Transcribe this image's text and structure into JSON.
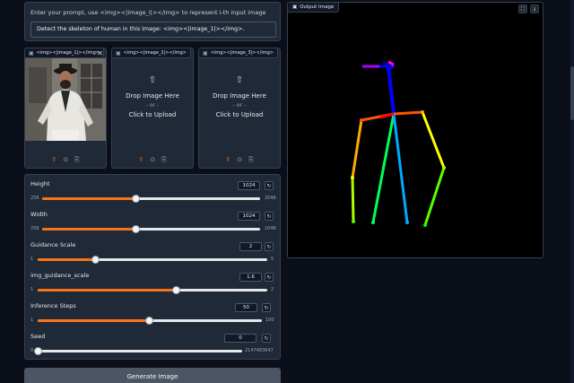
{
  "prompt": {
    "label": "Enter your prompt, use <img><|image_i|></img> to represent i-th input image",
    "value": "Detect the skeleton of human in this image: <img><|image_1|></img>."
  },
  "image_inputs": [
    {
      "label": "<img><|image_1|></img>",
      "has_image": true
    },
    {
      "label": "<img><|image_2|></img>",
      "drop_text": "Drop Image Here",
      "or_text": "- or -",
      "click_text": "Click to Upload"
    },
    {
      "label": "<img><|image_3|></img>",
      "drop_text": "Drop Image Here",
      "or_text": "- or -",
      "click_text": "Click to Upload"
    }
  ],
  "sliders": [
    {
      "label": "Height",
      "value": "1024",
      "min": "256",
      "max": "2048",
      "fraction": 0.43
    },
    {
      "label": "Width",
      "value": "1024",
      "min": "256",
      "max": "2048",
      "fraction": 0.43
    },
    {
      "label": "Guidance Scale",
      "value": "2",
      "min": "1",
      "max": "5",
      "fraction": 0.25
    },
    {
      "label": "img_guidance_scale",
      "value": "1.6",
      "min": "1",
      "max": "2",
      "fraction": 0.6
    },
    {
      "label": "Inference Steps",
      "value": "50",
      "min": "1",
      "max": "100",
      "fraction": 0.495
    },
    {
      "label": "Seed",
      "value": "0",
      "min": "0",
      "max": "2147483647",
      "fraction": 0.0
    }
  ],
  "generate_button": "Generate Image",
  "output": {
    "label": "Output Image"
  },
  "colors": {
    "accent": "#f97316",
    "background": "#0b0f19",
    "panel": "#1f2937"
  }
}
